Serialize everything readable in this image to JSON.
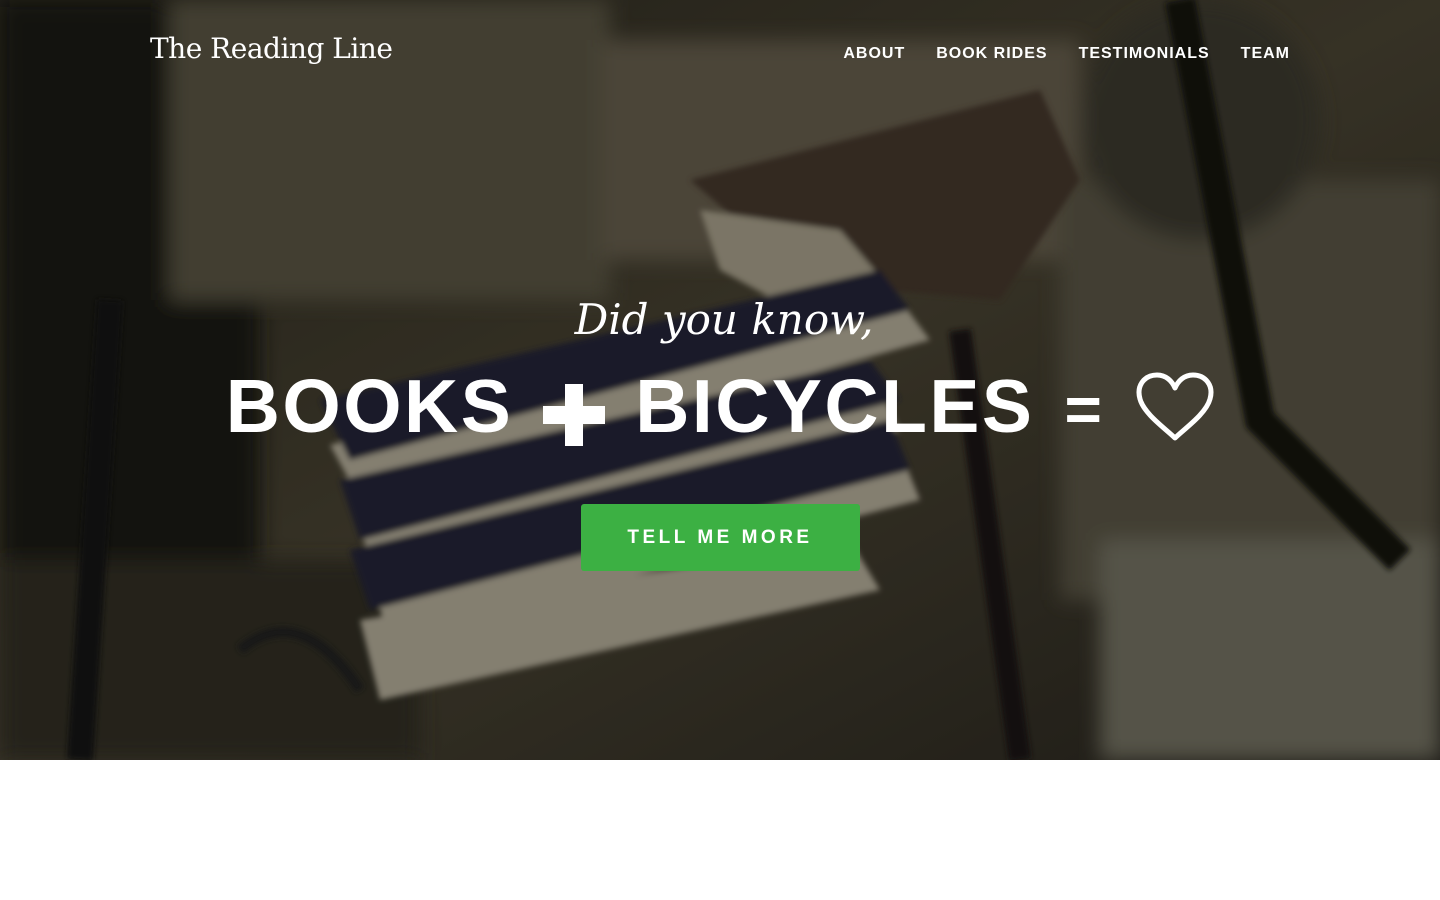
{
  "brand": {
    "name": "The Reading Line"
  },
  "nav": {
    "items": [
      {
        "label": "ABOUT"
      },
      {
        "label": "BOOK RIDES"
      },
      {
        "label": "TESTIMONIALS"
      },
      {
        "label": "TEAM"
      }
    ]
  },
  "hero": {
    "lead": "Did you know,",
    "headline_word_1": "BOOKS",
    "headline_word_2": "BICYCLES",
    "equals": "=",
    "cta_label": "TELL ME MORE",
    "icons": {
      "plus": "plus-icon",
      "heart": "heart-outline-icon"
    },
    "colors": {
      "cta": "#3cb043",
      "text": "#ffffff"
    }
  }
}
